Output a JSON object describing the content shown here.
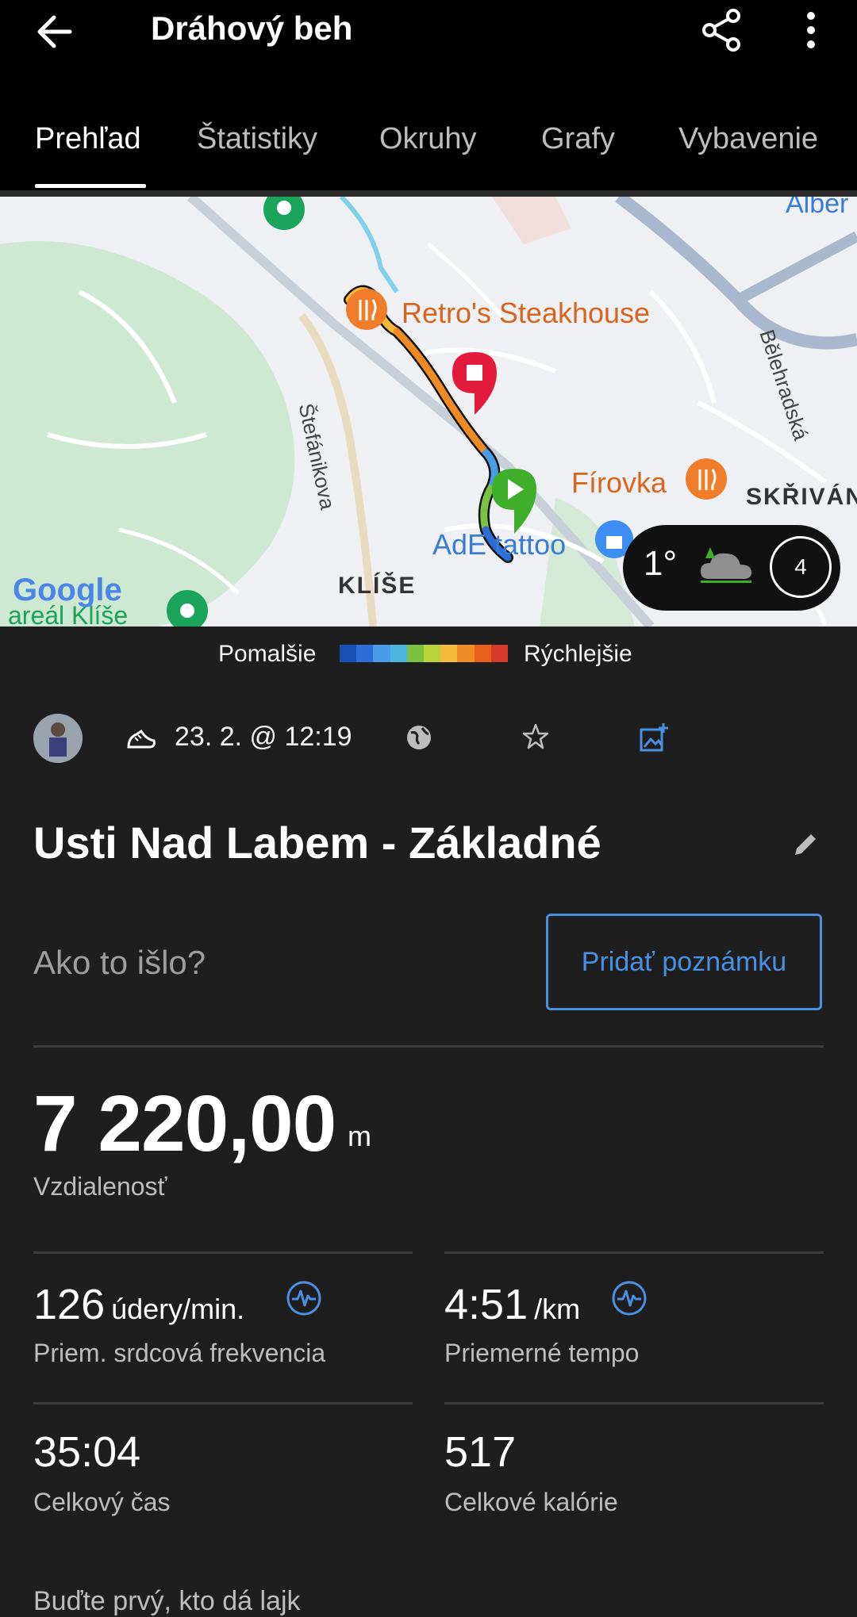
{
  "header": {
    "title": "Dráhový beh",
    "tabs": [
      {
        "label": "Prehľad",
        "active": true
      },
      {
        "label": "Štatistiky"
      },
      {
        "label": "Okruhy"
      },
      {
        "label": "Grafy"
      },
      {
        "label": "Vybavenie"
      }
    ]
  },
  "map": {
    "labels": {
      "restaurant1": "Retro's Steakhouse",
      "restaurant2": "Fírovka",
      "tattoo": "AdE tattoo",
      "street1": "Štefánikova",
      "street2": "Bělehradská",
      "district1": "KLÍŠE",
      "district2": "SKŘIVÁN",
      "park": "areál Klíše",
      "top_right": "Alber",
      "google": "Google"
    },
    "weather": {
      "temp": "1°",
      "laps": "4"
    }
  },
  "legend": {
    "slow": "Pomalšie",
    "fast": "Rýchlejšie",
    "colors": [
      "#1a4fb5",
      "#2b6fd6",
      "#4a9be8",
      "#4fb4e0",
      "#7cc242",
      "#b8d43a",
      "#f6b93b",
      "#f08a24",
      "#e8601c",
      "#d63a2a"
    ]
  },
  "meta": {
    "date": "23. 2. @ 12:19"
  },
  "activity": {
    "name": "Usti Nad Labem - Základné",
    "prompt": "Ako to išlo?",
    "add_note": "Pridať poznámku"
  },
  "stats": {
    "distance_value": "7 220,00",
    "distance_unit": "m",
    "distance_label": "Vzdialenosť",
    "hr_value": "126",
    "hr_unit": "údery/min.",
    "hr_label": "Priem. srdcová frekvencia",
    "pace_value": "4:51",
    "pace_unit": "/km",
    "pace_label": "Priemerné tempo",
    "time_value": "35:04",
    "time_label": "Celkový čas",
    "cal_value": "517",
    "cal_label": "Celkové kalórie"
  },
  "footer": {
    "likes": "Buďte prvý, kto dá lajk"
  },
  "colors": {
    "accent": "#4a90e2",
    "background": "#1e1e1e",
    "appbar": "#000000"
  }
}
